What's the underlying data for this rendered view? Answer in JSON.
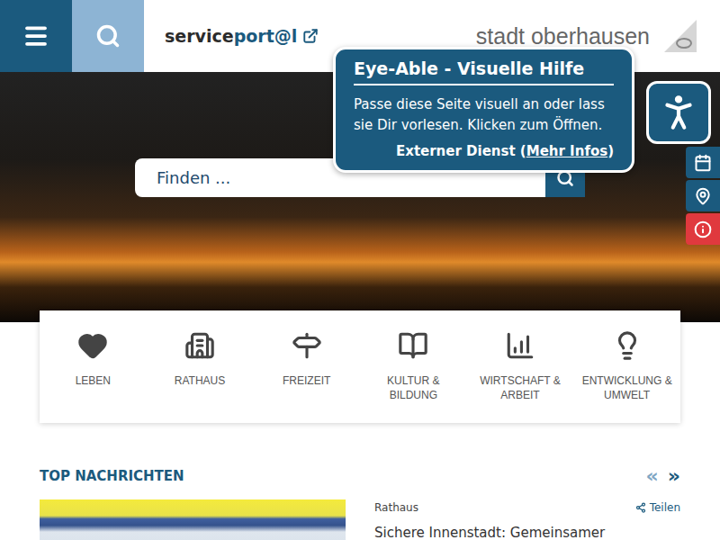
{
  "header": {
    "portal_prefix": "service",
    "portal_suffix": "port@l",
    "logo": "stadt oberhausen"
  },
  "search": {
    "placeholder": "Finden ..."
  },
  "tooltip": {
    "title": "Eye-Able - Visuelle Hilfe",
    "text": "Passe diese Seite visuell an oder lass sie Dir vorlesen. Klicken zum Öffnen.",
    "footer_prefix": "Externer Dienst (",
    "link": "Mehr Infos",
    "footer_suffix": ")"
  },
  "side_tools": [
    {
      "kind": "calendar",
      "color": "#1b5a7e"
    },
    {
      "kind": "location",
      "color": "#1b5a7e"
    },
    {
      "kind": "info",
      "color": "#e0393e"
    }
  ],
  "categories": [
    {
      "label": "LEBEN",
      "kind": "heart"
    },
    {
      "label": "RATHAUS",
      "kind": "building"
    },
    {
      "label": "FREIZEIT",
      "kind": "signpost"
    },
    {
      "label": "KULTUR & BILDUNG",
      "kind": "book"
    },
    {
      "label": "WIRTSCHAFT & ARBEIT",
      "kind": "chart"
    },
    {
      "label": "ENTWICKLUNG & UMWELT",
      "kind": "bulb"
    }
  ],
  "news": {
    "heading": "TOP NACHRICHTEN",
    "buttons": [
      {
        "label": "«",
        "disabled": true
      },
      {
        "label": "»",
        "disabled": false
      }
    ],
    "items": [
      {
        "category": "Rathaus",
        "share": "Teilen",
        "title": "Sichere Innenstadt: Gemeinsamer"
      }
    ]
  }
}
